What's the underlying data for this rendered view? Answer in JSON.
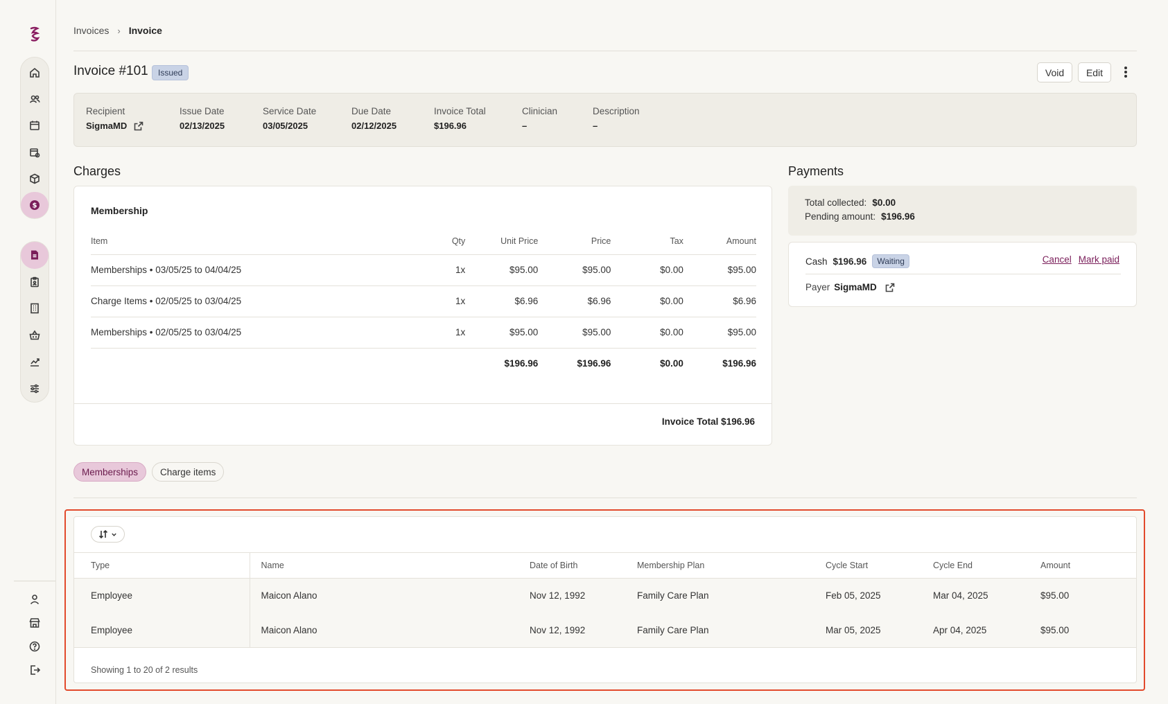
{
  "breadcrumb": {
    "root": "Invoices",
    "separator": "›",
    "current": "Invoice"
  },
  "invoice": {
    "title": "Invoice #101",
    "status": "Issued",
    "actions": {
      "void": "Void",
      "edit": "Edit"
    }
  },
  "summary": {
    "recipient": {
      "label": "Recipient",
      "value": "SigmaMD"
    },
    "issue_date": {
      "label": "Issue Date",
      "value": "02/13/2025"
    },
    "service_date": {
      "label": "Service Date",
      "value": "03/05/2025"
    },
    "due_date": {
      "label": "Due Date",
      "value": "02/12/2025"
    },
    "invoice_total": {
      "label": "Invoice Total",
      "value": "$196.96"
    },
    "clinician": {
      "label": "Clinician",
      "value": "–"
    },
    "description": {
      "label": "Description",
      "value": "–"
    }
  },
  "charges": {
    "title": "Charges",
    "group": "Membership",
    "columns": [
      "Item",
      "Qty",
      "Unit Price",
      "Price",
      "Tax",
      "Amount"
    ],
    "rows": [
      [
        "Memberships • 03/05/25 to 04/04/25",
        "1x",
        "$95.00",
        "$95.00",
        "$0.00",
        "$95.00"
      ],
      [
        "Charge Items • 02/05/25 to 03/04/25",
        "1x",
        "$6.96",
        "$6.96",
        "$0.00",
        "$6.96"
      ],
      [
        "Memberships • 02/05/25 to 03/04/25",
        "1x",
        "$95.00",
        "$95.00",
        "$0.00",
        "$95.00"
      ]
    ],
    "totals": [
      "",
      "",
      "$196.96",
      "$196.96",
      "$0.00",
      "$196.96"
    ],
    "invoice_total": "Invoice Total $196.96"
  },
  "payments": {
    "title": "Payments",
    "total_collected_label": "Total collected:",
    "total_collected": "$0.00",
    "pending_label": "Pending amount:",
    "pending": "$196.96",
    "method": "Cash",
    "amount": "$196.96",
    "status": "Waiting",
    "cancel": "Cancel",
    "mark_paid": "Mark paid",
    "payer_label": "Payer",
    "payer": "SigmaMD"
  },
  "tabs": [
    {
      "label": "Memberships",
      "active": true
    },
    {
      "label": "Charge items",
      "active": false
    }
  ],
  "memberships_table": {
    "columns": [
      "Type",
      "Name",
      "Date of Birth",
      "Membership Plan",
      "Cycle Start",
      "Cycle End",
      "Amount"
    ],
    "rows": [
      [
        "Employee",
        "Maicon Alano",
        "Nov 12, 1992",
        "Family Care Plan",
        "Feb 05, 2025",
        "Mar 04, 2025",
        "$95.00"
      ],
      [
        "Employee",
        "Maicon Alano",
        "Nov 12, 1992",
        "Family Care Plan",
        "Mar 05, 2025",
        "Apr 04, 2025",
        "$95.00"
      ]
    ],
    "footer": "Showing 1 to 20 of 2 results"
  },
  "colors": {
    "accent": "#7a1e5a",
    "accent_soft": "#e8c8da",
    "badge": "#c9d3e6",
    "highlight": "#e24a2c"
  }
}
